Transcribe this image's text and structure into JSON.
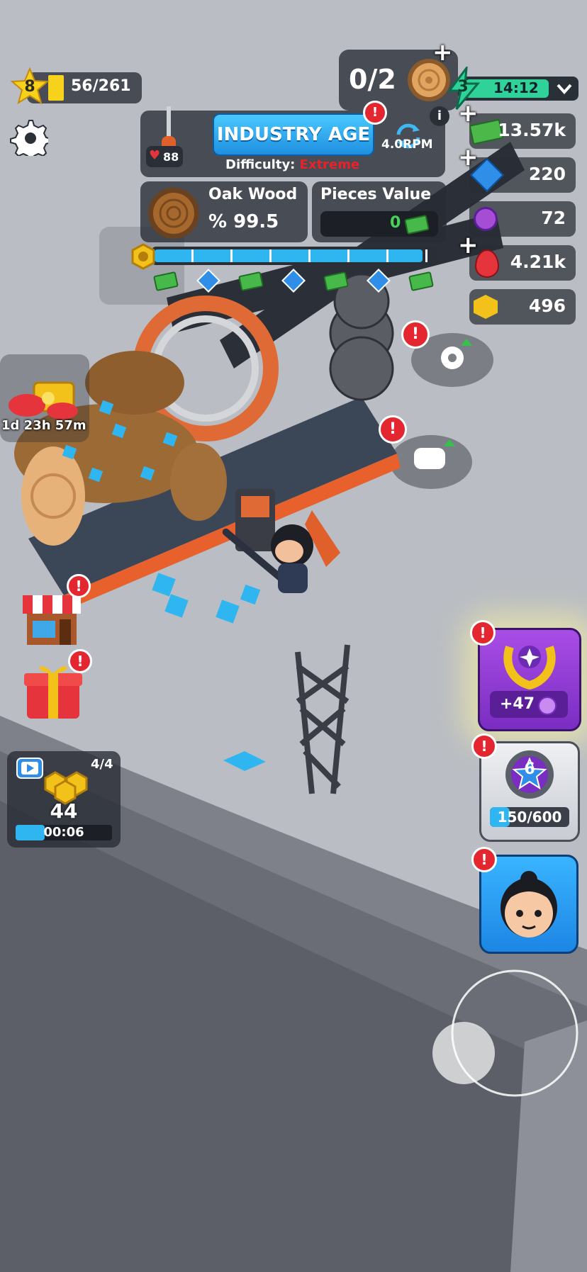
{
  "player": {
    "level": "8",
    "xp": "56/261"
  },
  "top_counter": {
    "value": "0/2"
  },
  "energy": {
    "count": "3",
    "timer": "14:12"
  },
  "industry": {
    "title": "INDUSTRY AGE",
    "difficulty_label": "Difficulty:",
    "difficulty_value": "Extreme",
    "health": "88",
    "rpm": "4.0RPM",
    "info": "i"
  },
  "wood": {
    "name": "Oak Wood",
    "percent": "% 99.5"
  },
  "pieces": {
    "label": "Pieces Value",
    "value": "0"
  },
  "progress": {
    "fraction": 0.97,
    "rewards": [
      "cash",
      "gem",
      "cash",
      "gem",
      "cash",
      "gem",
      "cash"
    ]
  },
  "resources": [
    {
      "name": "cash",
      "value": "13.57k",
      "has_plus": true,
      "color": "#4cb84a"
    },
    {
      "name": "gem",
      "value": "220",
      "has_plus": true,
      "color": "#2f8ee8"
    },
    {
      "name": "purple-coin",
      "value": "72",
      "has_plus": false,
      "color": "#a64dd6"
    },
    {
      "name": "ruby",
      "value": "4.21k",
      "has_plus": true,
      "color": "#e5343c"
    },
    {
      "name": "hex-nut",
      "value": "496",
      "has_plus": false,
      "color": "#f2c21b"
    }
  ],
  "offer_timer": "1d 23h 57m",
  "video_reward": {
    "count": "4/4",
    "amount": "44",
    "timer": "00:06",
    "fraction": 0.3
  },
  "prestige": {
    "reward": "+47"
  },
  "upgrades": {
    "level": "6",
    "progress": "150/600",
    "fraction": 0.25
  },
  "alert": "!",
  "colors": {
    "accent": "#2fb6f0",
    "alert": "#e3262f",
    "difficulty": "#e8222a",
    "energy": "#2fd39a"
  }
}
